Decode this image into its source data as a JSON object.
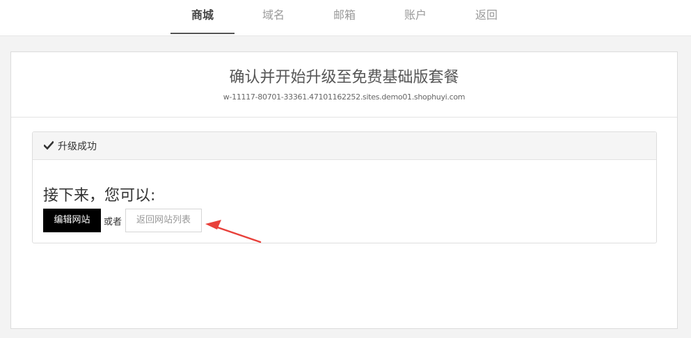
{
  "nav": {
    "tabs": [
      {
        "label": "商城",
        "active": true
      },
      {
        "label": "域名",
        "active": false
      },
      {
        "label": "邮箱",
        "active": false
      },
      {
        "label": "账户",
        "active": false
      },
      {
        "label": "返回",
        "active": false
      }
    ]
  },
  "header": {
    "title": "确认并开始升级至免费基础版套餐",
    "domain": "w-11117-80701-33361.47101162252.sites.demo01.shophuyi.com"
  },
  "card": {
    "icon": "check-icon",
    "title": "升级成功",
    "next_heading": "接下来，您可以:",
    "edit_button": "编辑网站",
    "or_text": "或者",
    "back_button": "返回网站列表"
  },
  "colors": {
    "accent_arrow": "#e8403a",
    "primary_button": "#000000"
  }
}
